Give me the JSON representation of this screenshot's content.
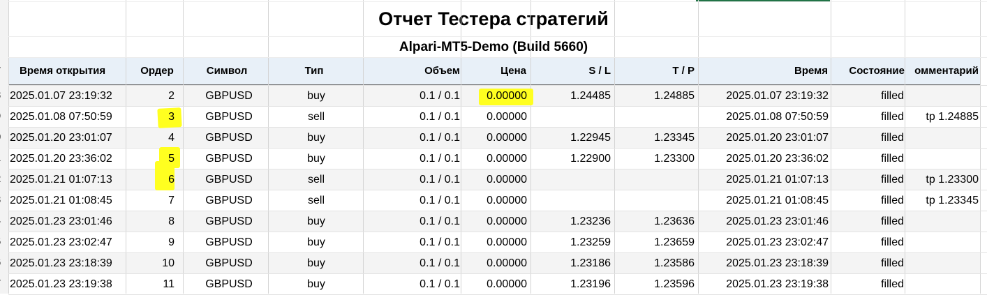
{
  "report": {
    "title": "Отчет Тестера стратегий",
    "subtitle": "Alpari-MT5-Demo (Build 5660)"
  },
  "row_numbers": [
    "7",
    "8",
    "9",
    "0",
    "1",
    "2",
    "3",
    "4",
    "5",
    "6",
    "7"
  ],
  "table": {
    "headers": [
      "Время открытия",
      "Ордер",
      "Символ",
      "Тип",
      "Объем",
      "Цена",
      "S / L",
      "T / P",
      "Время",
      "Состояние",
      "омментарий"
    ],
    "rows": [
      {
        "open_time": "2025.01.07 23:19:32",
        "order": "2",
        "symbol": "GBPUSD",
        "type": "buy",
        "volume": "0.1 / 0.1",
        "price": "0.00000",
        "sl": "1.24485",
        "tp": "1.24885",
        "time": "2025.01.07 23:19:32",
        "state": "filled",
        "comment": ""
      },
      {
        "open_time": "2025.01.08 07:50:59",
        "order": "3",
        "symbol": "GBPUSD",
        "type": "sell",
        "volume": "0.1 / 0.1",
        "price": "0.00000",
        "sl": "",
        "tp": "",
        "time": "2025.01.08 07:50:59",
        "state": "filled",
        "comment": "tp 1.24885"
      },
      {
        "open_time": "2025.01.20 23:01:07",
        "order": "4",
        "symbol": "GBPUSD",
        "type": "buy",
        "volume": "0.1 / 0.1",
        "price": "0.00000",
        "sl": "1.22945",
        "tp": "1.23345",
        "time": "2025.01.20 23:01:07",
        "state": "filled",
        "comment": ""
      },
      {
        "open_time": "2025.01.20 23:36:02",
        "order": "5",
        "symbol": "GBPUSD",
        "type": "buy",
        "volume": "0.1 / 0.1",
        "price": "0.00000",
        "sl": "1.22900",
        "tp": "1.23300",
        "time": "2025.01.20 23:36:02",
        "state": "filled",
        "comment": ""
      },
      {
        "open_time": "2025.01.21 01:07:13",
        "order": "6",
        "symbol": "GBPUSD",
        "type": "sell",
        "volume": "0.1 / 0.1",
        "price": "0.00000",
        "sl": "",
        "tp": "",
        "time": "2025.01.21 01:07:13",
        "state": "filled",
        "comment": "tp 1.23300"
      },
      {
        "open_time": "2025.01.21 01:08:45",
        "order": "7",
        "symbol": "GBPUSD",
        "type": "sell",
        "volume": "0.1 / 0.1",
        "price": "0.00000",
        "sl": "",
        "tp": "",
        "time": "2025.01.21 01:08:45",
        "state": "filled",
        "comment": "tp 1.23345"
      },
      {
        "open_time": "2025.01.23 23:01:46",
        "order": "8",
        "symbol": "GBPUSD",
        "type": "buy",
        "volume": "0.1 / 0.1",
        "price": "0.00000",
        "sl": "1.23236",
        "tp": "1.23636",
        "time": "2025.01.23 23:01:46",
        "state": "filled",
        "comment": ""
      },
      {
        "open_time": "2025.01.23 23:02:47",
        "order": "9",
        "symbol": "GBPUSD",
        "type": "buy",
        "volume": "0.1 / 0.1",
        "price": "0.00000",
        "sl": "1.23259",
        "tp": "1.23659",
        "time": "2025.01.23 23:02:47",
        "state": "filled",
        "comment": ""
      },
      {
        "open_time": "2025.01.23 23:18:39",
        "order": "10",
        "symbol": "GBPUSD",
        "type": "buy",
        "volume": "0.1 / 0.1",
        "price": "0.00000",
        "sl": "1.23186",
        "tp": "1.23586",
        "time": "2025.01.23 23:18:39",
        "state": "filled",
        "comment": ""
      },
      {
        "open_time": "2025.01.23 23:19:38",
        "order": "11",
        "symbol": "GBPUSD",
        "type": "buy",
        "volume": "0.1 / 0.1",
        "price": "0.00000",
        "sl": "1.23196",
        "tp": "1.23596",
        "time": "2025.01.23 23:19:38",
        "state": "filled",
        "comment": ""
      }
    ]
  },
  "highlight_color": "#ffff20"
}
